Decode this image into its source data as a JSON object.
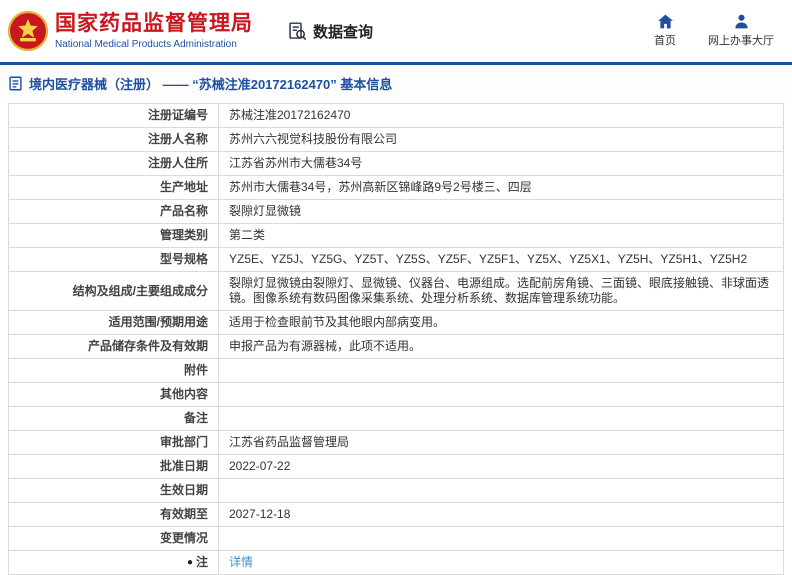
{
  "header": {
    "title": "国家药品监督管理局",
    "subtitle": "National Medical Products Administration",
    "query_label": "数据查询",
    "nav_home": "首页",
    "nav_hall": "网上办事大厅"
  },
  "breadcrumb": "境内医疗器械（注册） —— “苏械注准20172162470” 基本信息",
  "colors": {
    "brand_red": "#c8171e",
    "brand_blue": "#1e50a2",
    "link_blue": "#3a8fd9",
    "table_border": "#dadada"
  },
  "table": {
    "rows": [
      {
        "label": "注册证编号",
        "value": "苏械注准20172162470"
      },
      {
        "label": "注册人名称",
        "value": "苏州六六视觉科技股份有限公司"
      },
      {
        "label": "注册人住所",
        "value": "江苏省苏州市大儒巷34号"
      },
      {
        "label": "生产地址",
        "value": "苏州市大儒巷34号，苏州高新区锦峰路9号2号楼三、四层"
      },
      {
        "label": "产品名称",
        "value": "裂隙灯显微镜"
      },
      {
        "label": "管理类别",
        "value": "第二类"
      },
      {
        "label": "型号规格",
        "value": "YZ5E、YZ5J、YZ5G、YZ5T、YZ5S、YZ5F、YZ5F1、YZ5X、YZ5X1、YZ5H、YZ5H1、YZ5H2"
      },
      {
        "label": "结构及组成/主要组成成分",
        "value": "裂隙灯显微镜由裂隙灯、显微镜、仪器台、电源组成。选配前房角镜、三面镜、眼底接触镜、非球面透镜。图像系统有数码图像采集系统、处理分析系统、数据库管理系统功能。"
      },
      {
        "label": "适用范围/预期用途",
        "value": "适用于检查眼前节及其他眼内部病变用。"
      },
      {
        "label": "产品储存条件及有效期",
        "value": "申报产品为有源器械，此项不适用。"
      },
      {
        "label": "附件",
        "value": ""
      },
      {
        "label": "其他内容",
        "value": ""
      },
      {
        "label": "备注",
        "value": ""
      },
      {
        "label": "审批部门",
        "value": "江苏省药品监督管理局"
      },
      {
        "label": "批准日期",
        "value": "2022-07-22"
      },
      {
        "label": "生效日期",
        "value": ""
      },
      {
        "label": "有效期至",
        "value": "2027-12-18"
      },
      {
        "label": "变更情况",
        "value": ""
      },
      {
        "label": "注",
        "value": "详情",
        "link": true,
        "bullet": "●"
      }
    ]
  }
}
